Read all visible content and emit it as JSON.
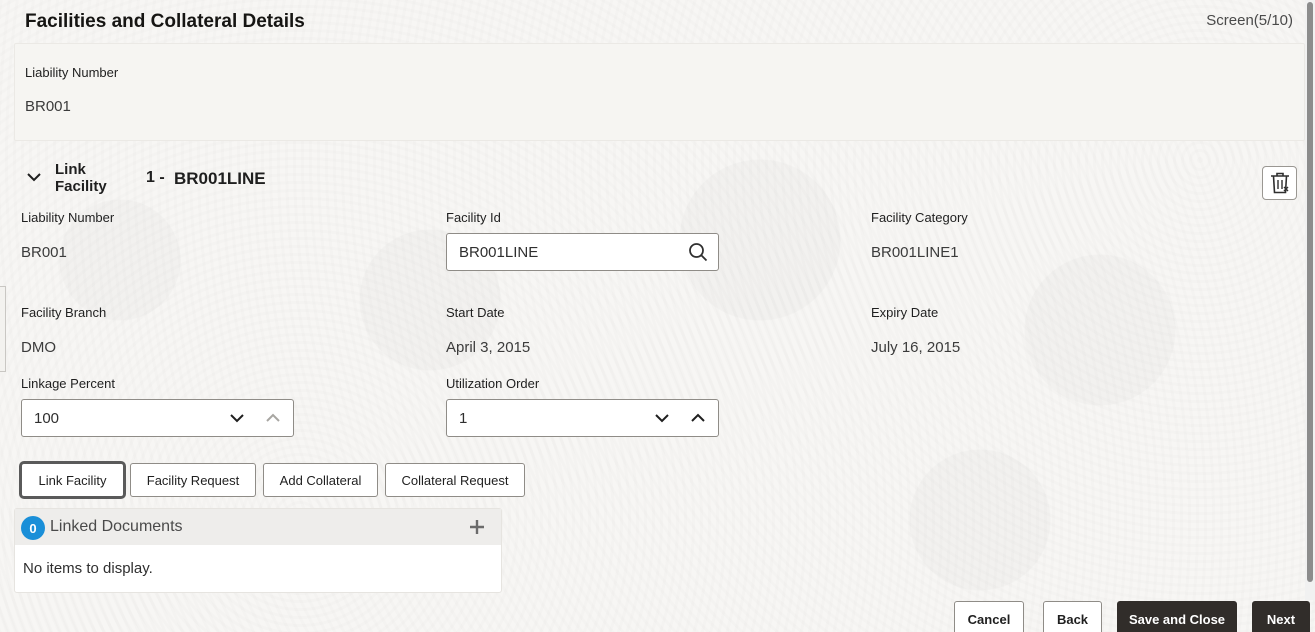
{
  "header": {
    "title": "Facilities and Collateral Details",
    "screen_indicator": "Screen(5/10)"
  },
  "summary": {
    "liability_label": "Liability Number",
    "liability_value": "BR001"
  },
  "section": {
    "label": "Link Facility",
    "number": "1 -",
    "id": "BR001LINE"
  },
  "fields": {
    "liability_number": {
      "label": "Liability Number",
      "value": "BR001"
    },
    "facility_id": {
      "label": "Facility Id",
      "value": "BR001LINE"
    },
    "facility_category": {
      "label": "Facility Category",
      "value": "BR001LINE1"
    },
    "facility_branch": {
      "label": "Facility Branch",
      "value": "DMO"
    },
    "start_date": {
      "label": "Start Date",
      "value": "April 3, 2015"
    },
    "expiry_date": {
      "label": "Expiry Date",
      "value": "July 16, 2015"
    },
    "linkage_percent": {
      "label": "Linkage Percent",
      "value": "100"
    },
    "utilization_order": {
      "label": "Utilization Order",
      "value": "1"
    }
  },
  "actions": {
    "link_facility": "Link Facility",
    "facility_request": "Facility Request",
    "add_collateral": "Add Collateral",
    "collateral_request": "Collateral Request"
  },
  "documents": {
    "count": "0",
    "title": "Linked Documents",
    "empty": "No items to display."
  },
  "footer": {
    "cancel": "Cancel",
    "back": "Back",
    "save_close": "Save and Close",
    "next": "Next"
  },
  "colors": {
    "primary_button": "#312d2a",
    "badge": "#1a8fd8",
    "border": "#8f8c87"
  }
}
